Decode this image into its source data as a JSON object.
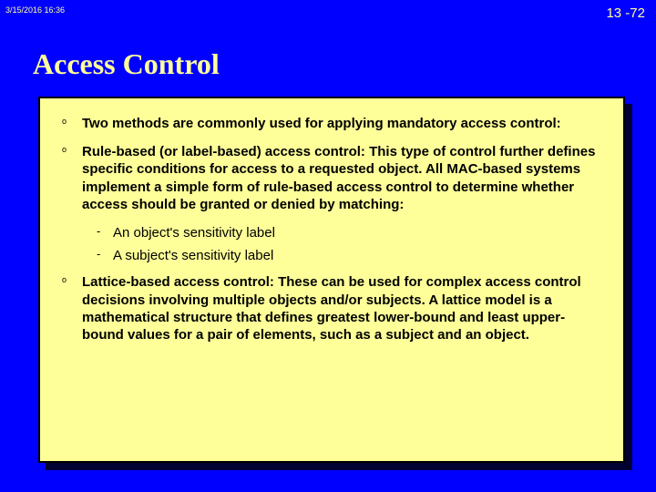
{
  "header": {
    "timestamp": "3/15/2016  16:36",
    "slide_number": "13 -72"
  },
  "title": "Access Control",
  "bullets": {
    "b0": "Two methods are commonly used for applying mandatory access control:",
    "b1": "Rule-based (or label-based) access control: This type of control further defines specific conditions for access to a requested object. All MAC-based systems implement a simple form of rule-based access control to determine whether access should be granted or denied by matching:",
    "b1_sub0": "An object's sensitivity label",
    "b1_sub1": "A subject's sensitivity label",
    "b2": "Lattice-based access control: These can be used for complex access control decisions involving multiple objects and/or subjects. A lattice model is a mathematical structure that defines greatest lower-bound and least upper-bound values for a pair of elements, such as a subject and an object."
  }
}
